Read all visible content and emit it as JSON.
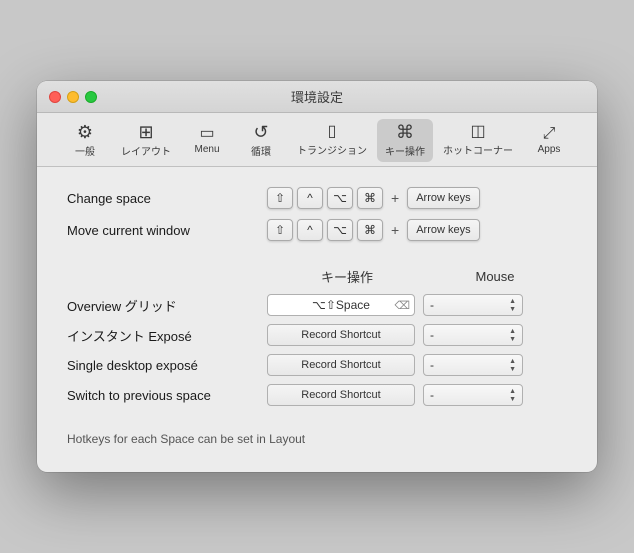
{
  "window": {
    "title": "環境設定"
  },
  "toolbar": {
    "items": [
      {
        "id": "general",
        "icon": "⚙",
        "label": "一般",
        "active": false
      },
      {
        "id": "layout",
        "icon": "⊞",
        "label": "レイアウト",
        "active": false
      },
      {
        "id": "menu",
        "icon": "▭",
        "label": "Menu",
        "active": false
      },
      {
        "id": "circulation",
        "icon": "↺",
        "label": "循環",
        "active": false
      },
      {
        "id": "transition",
        "icon": "▯",
        "label": "トランジション",
        "active": false
      },
      {
        "id": "keyop",
        "icon": "⌘",
        "label": "キー操作",
        "active": true
      },
      {
        "id": "hotcorner",
        "icon": "◫",
        "label": "ホットコーナー",
        "active": false
      },
      {
        "id": "apps",
        "icon": "⤢",
        "label": "Apps",
        "active": false
      }
    ]
  },
  "key_bindings": {
    "change_space": {
      "label": "Change space",
      "modifiers": [
        "⇧",
        "^",
        "⌥",
        "⌘"
      ],
      "plus": "+",
      "arrow_keys_label": "Arrow keys"
    },
    "move_window": {
      "label": "Move current window",
      "modifiers": [
        "⇧",
        "^",
        "⌥",
        "⌘"
      ],
      "plus": "+",
      "arrow_keys_label": "Arrow keys"
    }
  },
  "section_headers": {
    "keyboard": "キー操作",
    "mouse": "Mouse"
  },
  "settings": [
    {
      "id": "overview-grid",
      "label": "Overview グリッド",
      "keyboard_value": "⌥⇧Space",
      "has_clear": true,
      "mouse_value": "-"
    },
    {
      "id": "instant-expose",
      "label": "インスタント Exposé",
      "keyboard_value": "Record Shortcut",
      "has_clear": false,
      "mouse_value": "-"
    },
    {
      "id": "single-desktop-expose",
      "label": "Single desktop exposé",
      "keyboard_value": "Record Shortcut",
      "has_clear": false,
      "mouse_value": "-"
    },
    {
      "id": "switch-prev-space",
      "label": "Switch to previous space",
      "keyboard_value": "Record Shortcut",
      "has_clear": false,
      "mouse_value": "-"
    }
  ],
  "footer": {
    "note": "Hotkeys for each Space can be set in Layout"
  }
}
